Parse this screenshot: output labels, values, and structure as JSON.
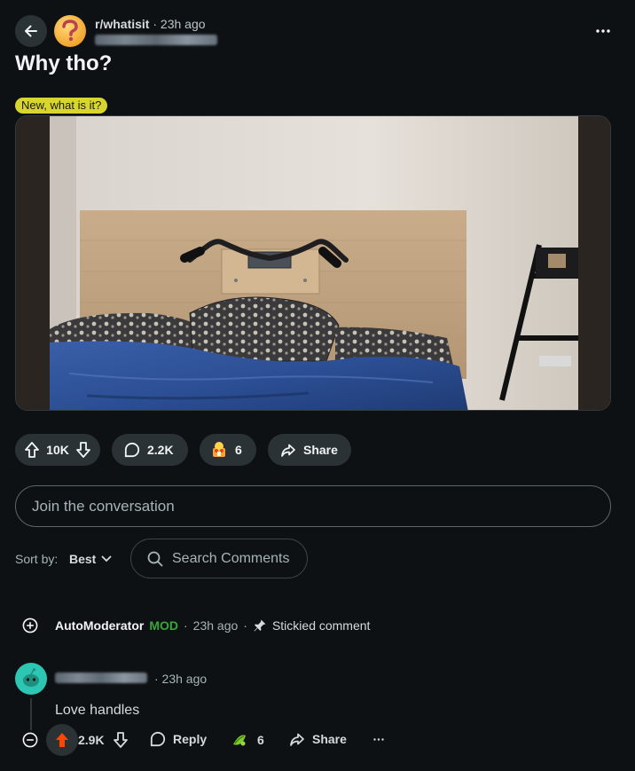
{
  "post": {
    "subreddit": "r/whatisit",
    "separator": "·",
    "age": "23h ago",
    "title": "Why tho?",
    "flair": "New, what is it?"
  },
  "actions": {
    "score": "10K",
    "comments": "2.2K",
    "awards": "6",
    "share": "Share"
  },
  "composer": {
    "placeholder": "Join the conversation"
  },
  "sort": {
    "label": "Sort by:",
    "value": "Best"
  },
  "search": {
    "placeholder": "Search Comments"
  },
  "automod": {
    "name": "AutoModerator",
    "badge": "MOD",
    "dot": "·",
    "age": "23h ago",
    "dot2": "·",
    "sticky": "Stickied comment"
  },
  "comment": {
    "age": "· 23h ago",
    "body": "Love handles",
    "score": "2.9K",
    "reply": "Reply",
    "awards": "6",
    "share": "Share"
  },
  "colors": {
    "background": "#0e1113",
    "pill": "#2a3236",
    "flair": "#d8d52f",
    "mod": "#37a737",
    "upvote": "#ff4500"
  }
}
